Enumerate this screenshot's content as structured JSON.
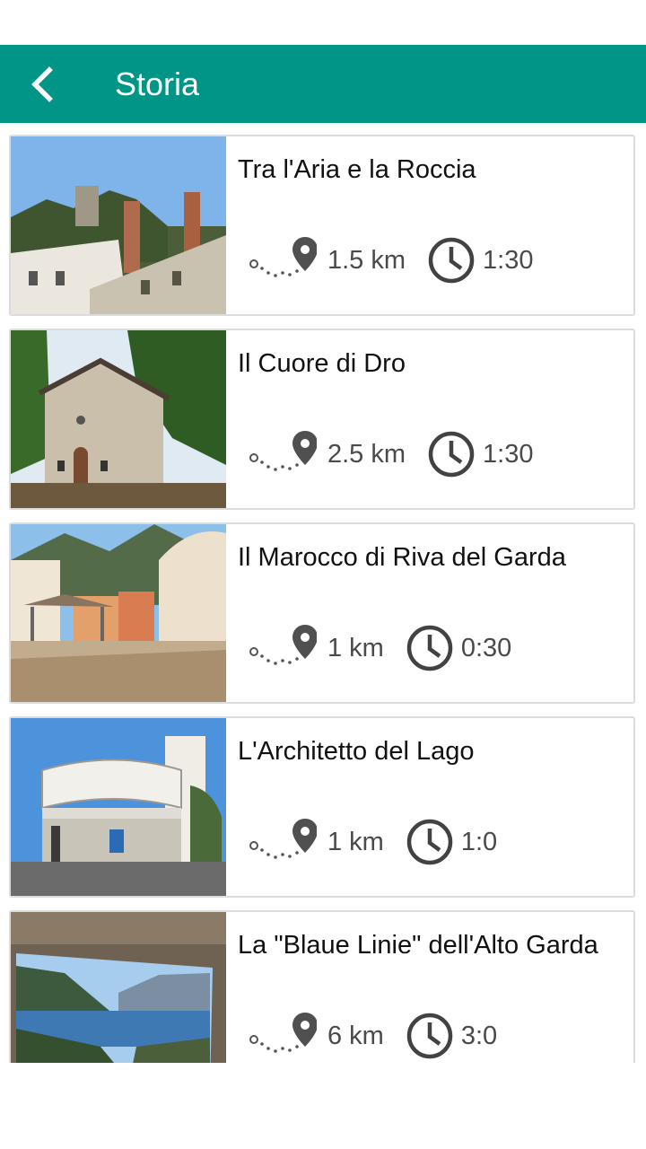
{
  "header": {
    "title": "Storia",
    "color": "#009587"
  },
  "back_icon": "chevron-left-icon",
  "routes": [
    {
      "title": "Tra l'Aria e la Roccia",
      "distance": "1.5 km",
      "duration": "1:30",
      "image": "castle-photo"
    },
    {
      "title": "Il Cuore di Dro",
      "distance": "2.5 km",
      "duration": "1:30",
      "image": "chapel-photo"
    },
    {
      "title": "Il Marocco di Riva del Garda",
      "distance": "1 km",
      "duration": "0:30",
      "image": "square-photo"
    },
    {
      "title": "L'Architetto del Lago",
      "distance": "1 km",
      "duration": "1:0",
      "image": "round-building-photo"
    },
    {
      "title": "La \"Blaue Linie\" dell'Alto Garda",
      "distance": "6 km",
      "duration": "3:0",
      "image": "lake-view-photo"
    }
  ],
  "icons": {
    "route": "route-pin-icon",
    "clock": "clock-icon"
  }
}
